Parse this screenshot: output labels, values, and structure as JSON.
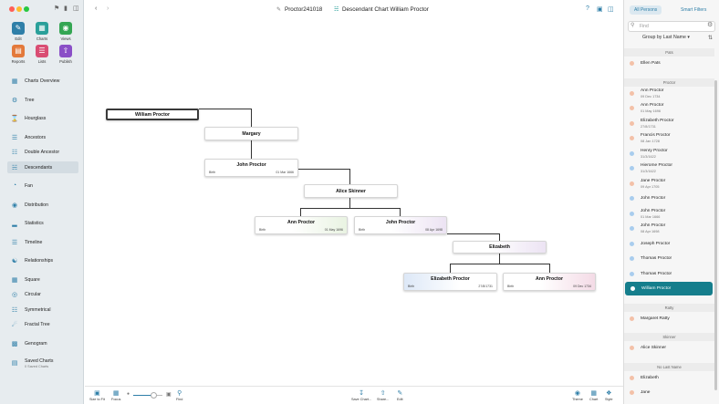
{
  "toolbar": {
    "doc_title": "Proctor241018",
    "chart_title": "Descendant Chart William Proctor"
  },
  "colors": {
    "accent": "#2f7fa8",
    "selected_row": "#157e8c",
    "female_dot": "#f3c1a8",
    "male_dot": "#a9cdee"
  },
  "tools": [
    {
      "label": "Edit",
      "color": "#2f7fa8",
      "icon": "pencil-icon"
    },
    {
      "label": "Charts",
      "color": "#2aa09a",
      "icon": "charts-icon"
    },
    {
      "label": "Views",
      "color": "#34a653",
      "icon": "eye-icon"
    },
    {
      "label": "Reports",
      "color": "#e3793b",
      "icon": "reports-icon"
    },
    {
      "label": "Lists",
      "color": "#d94d73",
      "icon": "lists-icon"
    },
    {
      "label": "Publish",
      "color": "#8a4fc7",
      "icon": "publish-icon"
    }
  ],
  "nav": [
    {
      "label": "Charts Overview",
      "icon": "overview-icon"
    },
    {
      "label": "Tree",
      "icon": "tree-icon"
    },
    {
      "label": "Hourglass",
      "icon": "hourglass-icon"
    },
    {
      "label": "Ancestors",
      "icon": "ancestors-icon"
    },
    {
      "label": "Double Ancestor",
      "icon": "double-ancestor-icon"
    },
    {
      "label": "Descendants",
      "icon": "descendants-icon",
      "selected": true
    },
    {
      "label": "Fan",
      "icon": "fan-icon"
    },
    {
      "label": "Distribution",
      "icon": "distribution-icon"
    },
    {
      "label": "Statistics",
      "icon": "statistics-icon"
    },
    {
      "label": "Timeline",
      "icon": "timeline-icon"
    },
    {
      "label": "Relationships",
      "icon": "relationships-icon"
    },
    {
      "label": "Square",
      "icon": "square-icon"
    },
    {
      "label": "Circular",
      "icon": "circular-icon"
    },
    {
      "label": "Symmetrical",
      "icon": "symmetrical-icon"
    },
    {
      "label": "Fractal Tree",
      "icon": "fractal-tree-icon"
    },
    {
      "label": "Genogram",
      "icon": "genogram-icon"
    },
    {
      "label": "Saved Charts",
      "sub": "0 Saved Charts",
      "icon": "saved-charts-icon"
    }
  ],
  "chart": {
    "nodes": [
      {
        "name": "William Proctor"
      },
      {
        "name": "Margary"
      },
      {
        "name": "John Proctor",
        "event": "Birth",
        "date": "01 Mar 1666"
      },
      {
        "name": "Alice Skinner"
      },
      {
        "name": "Ann Proctor",
        "event": "Birth",
        "date": "01 May 1696"
      },
      {
        "name": "John Proctor",
        "event": "Birth",
        "date": "08 Apr 1698"
      },
      {
        "name": "Elizabeth"
      },
      {
        "name": "Elizabeth Proctor",
        "event": "Birth",
        "date": "27/8/1731"
      },
      {
        "name": "Ann Proctor",
        "event": "Birth",
        "date": "09 Dec 1734"
      }
    ]
  },
  "bottombar": {
    "size_to_fit": "Size to Fit",
    "focus": "Focus",
    "find": "Find",
    "zoom_fraction": 0.7,
    "share_chart": "Save Chart...",
    "share": "Share...",
    "edit": "Edit",
    "theme": "Theme",
    "chart": "Chart",
    "style": "Style"
  },
  "rightpanel": {
    "tab_all": "All Persons",
    "tab_filters": "Smart Filters",
    "find_placeholder": "Find",
    "group_by": "Group by Last Name",
    "sections": [
      {
        "title": "Pats",
        "items": [
          {
            "name": "Ellen Pats",
            "sex": "f"
          }
        ]
      },
      {
        "title": "Proctor",
        "items": [
          {
            "name": "Ann Proctor",
            "date": "09 Dec 1734",
            "sex": "f"
          },
          {
            "name": "Ann Proctor",
            "date": "01 May 1696",
            "sex": "f"
          },
          {
            "name": "Elizabeth Proctor",
            "date": "27/8/1731",
            "sex": "f"
          },
          {
            "name": "Francis Proctor",
            "date": "08 Jan 1728",
            "sex": "f"
          },
          {
            "name": "Henry Proctor",
            "date": "31/3/1622",
            "sex": "m"
          },
          {
            "name": "Hierome Proctor",
            "date": "31/3/1622",
            "sex": "m"
          },
          {
            "name": "Jane Proctor",
            "date": "09 Apr 1705",
            "sex": "f"
          },
          {
            "name": "John Proctor",
            "sex": "m"
          },
          {
            "name": "John Proctor",
            "date": "01 Mar 1666",
            "sex": "m"
          },
          {
            "name": "John Proctor",
            "date": "08 Apr 1698",
            "sex": "m"
          },
          {
            "name": "Joseph Proctor",
            "sex": "m"
          },
          {
            "name": "Thomas Proctor",
            "sex": "m"
          },
          {
            "name": "Thomas Proctor",
            "sex": "m"
          },
          {
            "name": "William Proctor",
            "sex": "m",
            "selected": true
          }
        ]
      },
      {
        "title": "Ratty",
        "items": [
          {
            "name": "Margaret Ratty",
            "sex": "f"
          }
        ]
      },
      {
        "title": "Skinner",
        "items": [
          {
            "name": "Alice Skinner",
            "sex": "f"
          }
        ]
      },
      {
        "title": "No Last Name",
        "items": [
          {
            "name": "Elizabeth",
            "sex": "f"
          },
          {
            "name": "Jane",
            "sex": "f"
          }
        ]
      }
    ]
  }
}
